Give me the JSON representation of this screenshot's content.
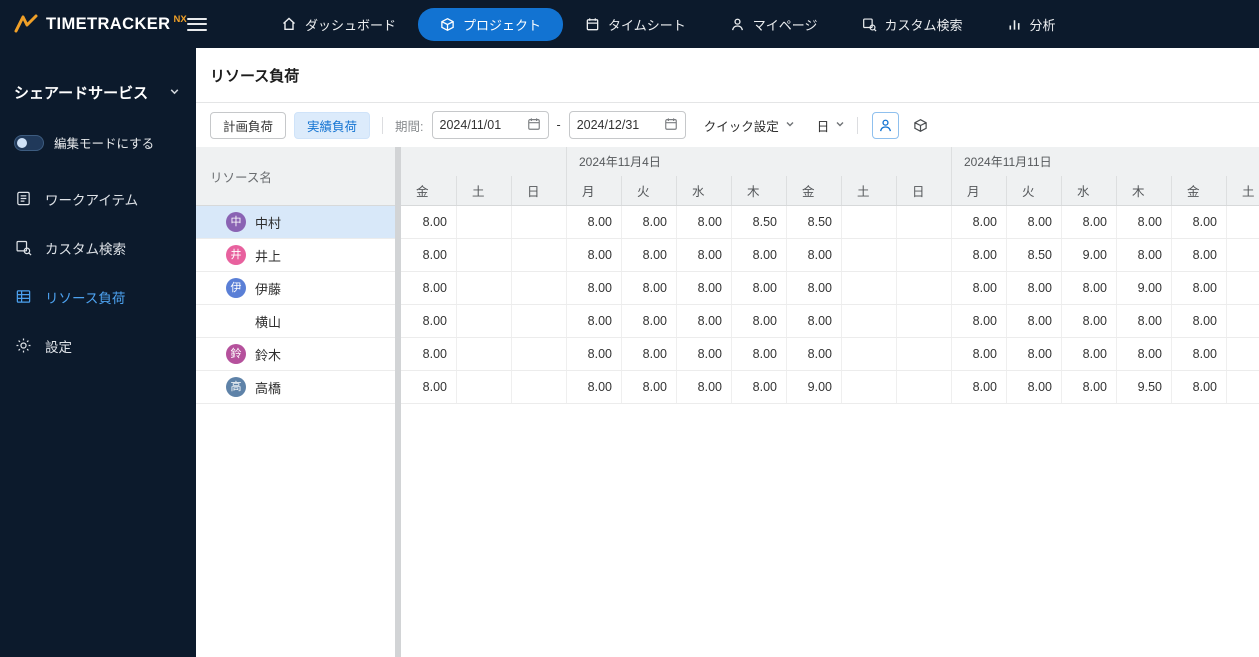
{
  "topbar": {
    "brand": "TIMETRACKER",
    "brand_suffix": "NX",
    "nav": [
      {
        "label": "ダッシュボード",
        "icon": "home-icon",
        "active": false
      },
      {
        "label": "プロジェクト",
        "icon": "project-icon",
        "active": true
      },
      {
        "label": "タイムシート",
        "icon": "timesheet-icon",
        "active": false
      },
      {
        "label": "マイページ",
        "icon": "mypage-icon",
        "active": false
      },
      {
        "label": "カスタム検索",
        "icon": "custom-search-icon",
        "active": false
      },
      {
        "label": "分析",
        "icon": "analytics-icon",
        "active": false
      }
    ]
  },
  "sidebar": {
    "workspace_title": "シェアードサービス",
    "edit_mode_label": "編集モードにする",
    "items": [
      {
        "label": "ワークアイテム",
        "icon": "workitem-icon",
        "active": false
      },
      {
        "label": "カスタム検索",
        "icon": "search-icon",
        "active": false
      },
      {
        "label": "リソース負荷",
        "icon": "resource-load-icon",
        "active": true
      },
      {
        "label": "設定",
        "icon": "gear-icon",
        "active": false
      }
    ]
  },
  "page": {
    "title": "リソース負荷"
  },
  "toolbar": {
    "planned_button": "計画負荷",
    "actual_button": "実績負荷",
    "period_label": "期間:",
    "date_from": "2024/11/01",
    "range_separator": "-",
    "date_to": "2024/12/31",
    "quick_settings": "クイック設定",
    "granularity": "日"
  },
  "table": {
    "resource_header": "リソース名",
    "week_groups": [
      {
        "label": "",
        "span": 3
      },
      {
        "label": "2024年11月4日",
        "span": 7
      },
      {
        "label": "2024年11月11日",
        "span": 6
      }
    ],
    "days": [
      "金",
      "土",
      "日",
      "月",
      "火",
      "水",
      "木",
      "金",
      "土",
      "日",
      "月",
      "火",
      "水",
      "木",
      "金",
      "土"
    ],
    "rows": [
      {
        "name": "中村",
        "initial": "中",
        "avatar_color": "#8a63b3",
        "selected": true,
        "values": [
          "8.00",
          "",
          "",
          "8.00",
          "8.00",
          "8.00",
          "8.50",
          "8.50",
          "",
          "",
          "8.00",
          "8.00",
          "8.00",
          "8.00",
          "8.00",
          ""
        ]
      },
      {
        "name": "井上",
        "initial": "井",
        "avatar_color": "#e8619e",
        "selected": false,
        "values": [
          "8.00",
          "",
          "",
          "8.00",
          "8.00",
          "8.00",
          "8.00",
          "8.00",
          "",
          "",
          "8.00",
          "8.50",
          "9.00",
          "8.00",
          "8.00",
          ""
        ]
      },
      {
        "name": "伊藤",
        "initial": "伊",
        "avatar_color": "#5a7fd6",
        "selected": false,
        "values": [
          "8.00",
          "",
          "",
          "8.00",
          "8.00",
          "8.00",
          "8.00",
          "8.00",
          "",
          "",
          "8.00",
          "8.00",
          "8.00",
          "9.00",
          "8.00",
          ""
        ]
      },
      {
        "name": "横山",
        "initial": "",
        "avatar_color": "",
        "selected": false,
        "values": [
          "8.00",
          "",
          "",
          "8.00",
          "8.00",
          "8.00",
          "8.00",
          "8.00",
          "",
          "",
          "8.00",
          "8.00",
          "8.00",
          "8.00",
          "8.00",
          ""
        ]
      },
      {
        "name": "鈴木",
        "initial": "鈴",
        "avatar_color": "#b5519c",
        "selected": false,
        "values": [
          "8.00",
          "",
          "",
          "8.00",
          "8.00",
          "8.00",
          "8.00",
          "8.00",
          "",
          "",
          "8.00",
          "8.00",
          "8.00",
          "8.00",
          "8.00",
          ""
        ]
      },
      {
        "name": "高橋",
        "initial": "高",
        "avatar_color": "#5e82a8",
        "selected": false,
        "values": [
          "8.00",
          "",
          "",
          "8.00",
          "8.00",
          "8.00",
          "8.00",
          "9.00",
          "",
          "",
          "8.00",
          "8.00",
          "8.00",
          "9.50",
          "8.00",
          ""
        ]
      }
    ]
  },
  "colors": {
    "topbar_bg": "#0c1a2c",
    "accent_blue": "#1273d2",
    "active_sidebar_link": "#4da2f0",
    "brand_orange": "#f0a028",
    "selected_row_bg": "#d8e8f9"
  }
}
